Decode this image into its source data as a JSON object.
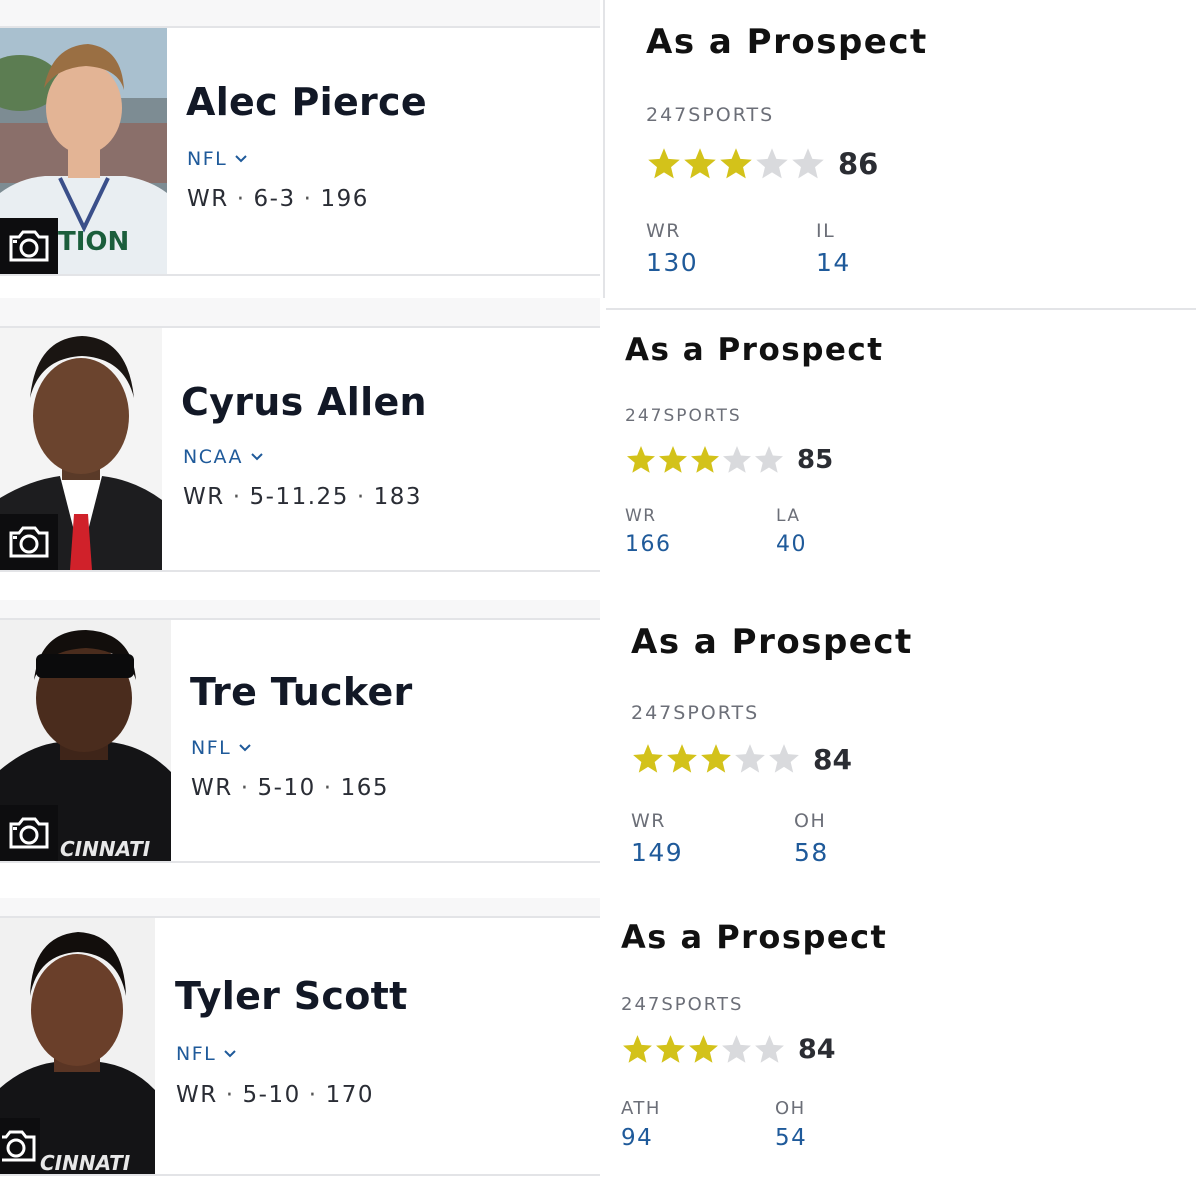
{
  "section_title": "As a Prospect",
  "source_label": "247SPORTS",
  "colors": {
    "star_on": "#d3c21a",
    "star_off": "#d9dadd",
    "link": "#1f5a9a"
  },
  "players": [
    {
      "name": "Alec Pierce",
      "league": "NFL",
      "position": "WR",
      "height": "6-3",
      "weight": "196",
      "stars": 3,
      "rating": "86",
      "ranks": [
        {
          "label": "WR",
          "value": "130"
        },
        {
          "label": "IL",
          "value": "14"
        }
      ],
      "photo_shirt_text": "TION"
    },
    {
      "name": "Cyrus Allen",
      "league": "NCAA",
      "position": "WR",
      "height": "5-11.25",
      "weight": "183",
      "stars": 3,
      "rating": "85",
      "ranks": [
        {
          "label": "WR",
          "value": "166"
        },
        {
          "label": "LA",
          "value": "40"
        }
      ],
      "photo_shirt_text": ""
    },
    {
      "name": "Tre Tucker",
      "league": "NFL",
      "position": "WR",
      "height": "5-10",
      "weight": "165",
      "stars": 3,
      "rating": "84",
      "ranks": [
        {
          "label": "WR",
          "value": "149"
        },
        {
          "label": "OH",
          "value": "58"
        }
      ],
      "photo_shirt_text": "CINNATI"
    },
    {
      "name": "Tyler Scott",
      "league": "NFL",
      "position": "WR",
      "height": "5-10",
      "weight": "170",
      "stars": 3,
      "rating": "84",
      "ranks": [
        {
          "label": "ATH",
          "value": "94"
        },
        {
          "label": "OH",
          "value": "54"
        }
      ],
      "photo_shirt_text": "CINNATI"
    }
  ]
}
